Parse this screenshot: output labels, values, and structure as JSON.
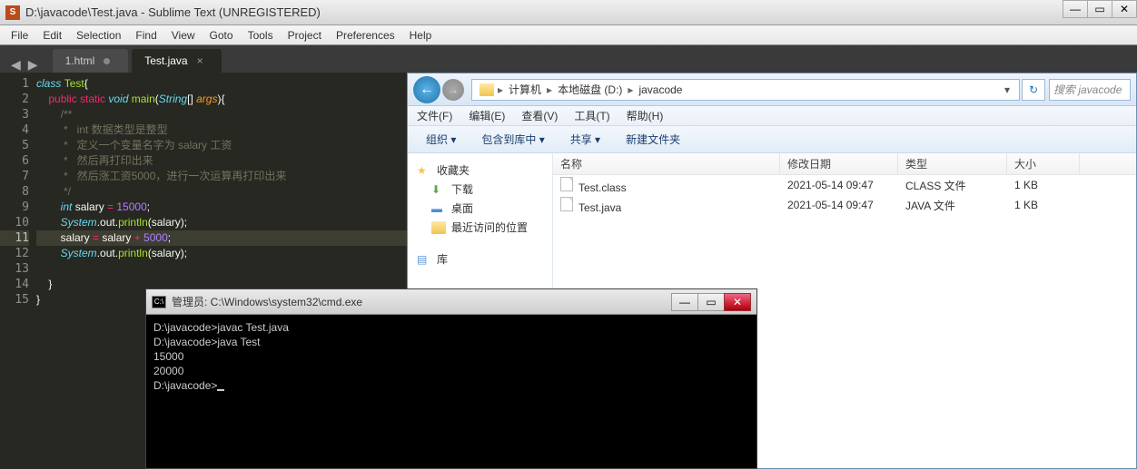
{
  "title": "D:\\javacode\\Test.java - Sublime Text (UNREGISTERED)",
  "title_icon": "S",
  "menu": {
    "file": "File",
    "edit": "Edit",
    "selection": "Selection",
    "find": "Find",
    "view": "View",
    "goto": "Goto",
    "tools": "Tools",
    "project": "Project",
    "preferences": "Preferences",
    "help": "Help"
  },
  "tabs": [
    {
      "label": "1.html",
      "active": false,
      "dirty": true
    },
    {
      "label": "Test.java",
      "active": true,
      "dirty": false
    }
  ],
  "gutter": [
    "1",
    "2",
    "3",
    "4",
    "5",
    "6",
    "7",
    "8",
    "9",
    "10",
    "11",
    "12",
    "13",
    "14",
    "15"
  ],
  "code": {
    "l1_class": "class ",
    "l1_name": "Test",
    "l1_brace": "{",
    "l2_ind": "    ",
    "l2_pub": "public ",
    "l2_static": "static ",
    "l2_void": "void ",
    "l2_main": "main",
    "l2_p1": "(",
    "l2_str": "String",
    "l2_br": "[] ",
    "l2_args": "args",
    "l2_p2": "){",
    "l3": "        /**",
    "l4": "         *   int 数据类型是整型",
    "l5": "         *   定义一个变量名字为 salary 工资",
    "l6": "         *   然后再打印出来",
    "l7": "         *   然后涨工资5000，进行一次运算再打印出来",
    "l8": "         */",
    "l9_ind": "        ",
    "l9_int": "int ",
    "l9_var": "salary ",
    "l9_eq": "= ",
    "l9_num": "15000",
    "l9_sc": ";",
    "l10_ind": "        ",
    "l10_sys": "System",
    "l10_d1": ".",
    "l10_out": "out",
    "l10_d2": ".",
    "l10_pr": "println",
    "l10_p": "(salary);",
    "l11_ind": "        ",
    "l11_v1": "salary ",
    "l11_eq": "= ",
    "l11_v2": "salary ",
    "l11_plus": "+ ",
    "l11_num": "5000",
    "l11_sc": ";",
    "l12_ind": "        ",
    "l12_sys": "System",
    "l12_d1": ".",
    "l12_out": "out",
    "l12_d2": ".",
    "l12_pr": "println",
    "l12_p": "(salary);",
    "l13": "",
    "l14": "    }",
    "l15": "}"
  },
  "explorer": {
    "crumbs": [
      "计算机",
      "本地磁盘 (D:)",
      "javacode"
    ],
    "search_placeholder": "搜索 javacode",
    "menu": {
      "file": "文件(F)",
      "edit": "编辑(E)",
      "view": "查看(V)",
      "tools": "工具(T)",
      "help": "帮助(H)"
    },
    "toolbar": {
      "org": "组织 ▾",
      "inc": "包含到库中 ▾",
      "share": "共享 ▾",
      "new": "新建文件夹"
    },
    "sidebar": {
      "fav": "收藏夹",
      "dl": "下载",
      "desk": "桌面",
      "recent": "最近访问的位置",
      "lib": "库"
    },
    "cols": {
      "name": "名称",
      "date": "修改日期",
      "type": "类型",
      "size": "大小"
    },
    "rows": [
      {
        "name": "Test.class",
        "date": "2021-05-14 09:47",
        "type": "CLASS 文件",
        "size": "1 KB"
      },
      {
        "name": "Test.java",
        "date": "2021-05-14 09:47",
        "type": "JAVA 文件",
        "size": "1 KB"
      }
    ]
  },
  "cmd": {
    "title": "管理员: C:\\Windows\\system32\\cmd.exe",
    "lines": [
      "D:\\javacode>javac Test.java",
      "",
      "D:\\javacode>java Test",
      "15000",
      "20000",
      "",
      "D:\\javacode>"
    ]
  }
}
